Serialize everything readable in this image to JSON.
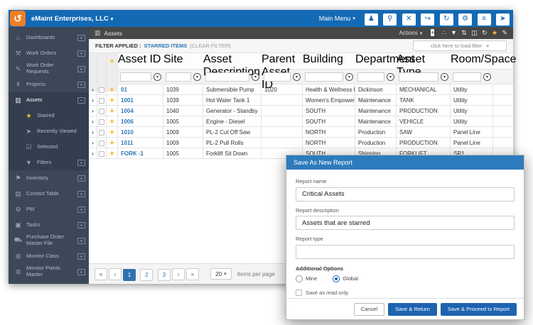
{
  "colors": {
    "topbar_blue": "#1469b4",
    "logo_orange": "#f07f23",
    "sidebar_bg": "#3c4758",
    "sidebar_group": "#333e4f",
    "toolbar_dark": "#474747",
    "star_yellow": "#f2c230",
    "link_blue": "#2f77b6",
    "active_page": "#2e72ae",
    "dialog_header": "#2d7bbd",
    "accent_blue": "#1d63b0"
  },
  "icons": {
    "logo": "↺",
    "caret_down": "▾",
    "row_expander": "›",
    "star": "★",
    "filter_drop": "▾"
  },
  "topbar": {
    "title": "eMaint Enterprises, LLC",
    "main_menu_label": "Main Menu",
    "buttons": [
      {
        "name": "user-icon",
        "glyph": "♟"
      },
      {
        "name": "pin-icon",
        "glyph": "⚲"
      },
      {
        "name": "close-icon",
        "glyph": "✕"
      },
      {
        "name": "exit-icon",
        "glyph": "↪"
      },
      {
        "name": "refresh-icon",
        "glyph": "↻"
      },
      {
        "name": "gear-icon",
        "glyph": "⚙"
      },
      {
        "name": "menu-icon",
        "glyph": "≡"
      },
      {
        "name": "navigate-icon",
        "glyph": "➤"
      }
    ]
  },
  "sidebar": {
    "items": [
      {
        "label": "Dashboards",
        "icon": "home-icon",
        "glyph": "⌂",
        "expander": "+",
        "state": ""
      },
      {
        "label": "Work Orders",
        "icon": "wrench-icon",
        "glyph": "⚒",
        "expander": "+",
        "state": ""
      },
      {
        "label": "Work Order Requests",
        "icon": "request-icon",
        "glyph": "✎",
        "expander": "+",
        "state": ""
      },
      {
        "label": "Projects",
        "icon": "trophy-icon",
        "glyph": "⚱",
        "expander": "+",
        "state": ""
      },
      {
        "label": "Assets",
        "icon": "barcode-icon",
        "glyph": "▥",
        "expander": "−",
        "state": "group active"
      },
      {
        "label": "Starred",
        "icon": "star-icon",
        "glyph": "★",
        "expander": "",
        "state": "group sub star"
      },
      {
        "label": "Recently Viewed",
        "icon": "send-icon",
        "glyph": "➤",
        "expander": "",
        "state": "group sub"
      },
      {
        "label": "Selected",
        "icon": "checkbox-icon",
        "glyph": "☑",
        "expander": "",
        "state": "group sub"
      },
      {
        "label": "Filters",
        "icon": "filter-icon",
        "glyph": "▼",
        "expander": "+",
        "state": "group sub"
      },
      {
        "label": "Inventory",
        "icon": "tag-icon",
        "glyph": "⚑",
        "expander": "+",
        "state": ""
      },
      {
        "label": "Contact Table",
        "icon": "book-icon",
        "glyph": "▤",
        "expander": "+",
        "state": ""
      },
      {
        "label": "PM",
        "icon": "gears-icon",
        "glyph": "⚙",
        "expander": "+",
        "state": ""
      },
      {
        "label": "Tasks",
        "icon": "tasks-icon",
        "glyph": "▣",
        "expander": "+",
        "state": ""
      },
      {
        "label": "Purchase Order Master File",
        "icon": "truck-icon",
        "glyph": "⛟",
        "expander": "+",
        "state": ""
      },
      {
        "label": "Monitor Class",
        "icon": "grid-icon",
        "glyph": "⊞",
        "expander": "+",
        "state": ""
      },
      {
        "label": "Monitor Points Master",
        "icon": "grid-icon",
        "glyph": "⊞",
        "expander": "+",
        "state": ""
      }
    ]
  },
  "content": {
    "toolbar": {
      "title": "Assets",
      "title_glyph": "▥",
      "actions_label": "Actions",
      "icons": [
        {
          "name": "add-icon",
          "glyph": "+",
          "style": "boxed"
        },
        {
          "name": "placeholder-icon",
          "glyph": "",
          "style": "disabled"
        },
        {
          "name": "share-icon",
          "glyph": "∴",
          "style": ""
        },
        {
          "name": "filter-icon",
          "glyph": "▼",
          "style": ""
        },
        {
          "name": "sort-icon",
          "glyph": "⇅",
          "style": ""
        },
        {
          "name": "columns-icon",
          "glyph": "◫",
          "style": ""
        },
        {
          "name": "refresh-icon",
          "glyph": "↻",
          "style": ""
        },
        {
          "name": "star-icon",
          "glyph": "★",
          "style": "star"
        },
        {
          "name": "edit-icon",
          "glyph": "✎",
          "style": ""
        }
      ]
    },
    "filter_bar": {
      "label": "FILTER APPLIED :",
      "filter_name": "STARRED ITEMS",
      "clear_label": "(CLEAR FILTER)",
      "load_filter_placeholder": "click here to load filter"
    },
    "table": {
      "columns": [
        {
          "label": "Asset ID"
        },
        {
          "label": "Site"
        },
        {
          "label": "Asset Description"
        },
        {
          "label": "Parent Asset ID"
        },
        {
          "label": "Building"
        },
        {
          "label": "Department"
        },
        {
          "label": "Asset Type"
        },
        {
          "label": "Room/Space"
        }
      ],
      "rows": [
        {
          "asset_id": "01",
          "site": "1039",
          "description": "Submersible Pump",
          "parent_asset_id": "1020",
          "building": "Health & Wellness Hall",
          "department": "Dickinson",
          "asset_type": "MECHANICAL",
          "room_space": "Utility"
        },
        {
          "asset_id": "1001",
          "site": "1039",
          "description": "Hot Water Tank 1",
          "parent_asset_id": "",
          "building": "Women's Empowerm...",
          "department": "Maintenance",
          "asset_type": "TANK",
          "room_space": "Utility"
        },
        {
          "asset_id": "1004",
          "site": "1040",
          "description": "Generator - Standby",
          "parent_asset_id": "",
          "building": "SOUTH",
          "department": "Maintenance",
          "asset_type": "PRODUCTION",
          "room_space": "Utility"
        },
        {
          "asset_id": "1006",
          "site": "1005",
          "description": "Engine - Diesel",
          "parent_asset_id": "",
          "building": "SOUTH",
          "department": "Maintenance",
          "asset_type": "VEHICLE",
          "room_space": "Utility"
        },
        {
          "asset_id": "1010",
          "site": "1009",
          "description": "PL-2 Cut Off Saw",
          "parent_asset_id": "",
          "building": "NORTH",
          "department": "Production",
          "asset_type": "SAW",
          "room_space": "Panel Line"
        },
        {
          "asset_id": "1011",
          "site": "1009",
          "description": "PL-2 Pull Rolls",
          "parent_asset_id": "",
          "building": "NORTH",
          "department": "Production",
          "asset_type": "PRODUCTION",
          "room_space": "Panel Line"
        },
        {
          "asset_id": "FORK -1",
          "site": "1005",
          "description": "Forklift Sit Down",
          "parent_asset_id": "",
          "building": "SOUTH",
          "department": "Shipping",
          "asset_type": "FORKLIFT",
          "room_space": "SR1"
        }
      ]
    },
    "pagination": {
      "first": "«",
      "prev": "‹",
      "pages": [
        {
          "label": "1",
          "state": "active"
        },
        {
          "label": "2",
          "state": ""
        },
        {
          "label": "3",
          "state": ""
        }
      ],
      "next": "›",
      "last": "»",
      "page_size": "20",
      "items_label": "items per page"
    }
  },
  "dialog": {
    "title": "Save As New Report",
    "report_name_label": "Report name",
    "report_name_value": "Critical Assets",
    "report_description_label": "Report description",
    "report_description_value": "Assets that are starred",
    "report_type_label": "Report type",
    "report_type_value": "",
    "additional_options_label": "Additional Options",
    "radio_mine_label": "Mine",
    "radio_global_label": "Global",
    "selected_radio": "Global",
    "checkbox_label": "Save as read only",
    "checkbox_checked": false,
    "cancel_label": "Cancel",
    "save_return_label": "Save & Return",
    "save_proceed_label": "Save & Proceed to Report"
  }
}
